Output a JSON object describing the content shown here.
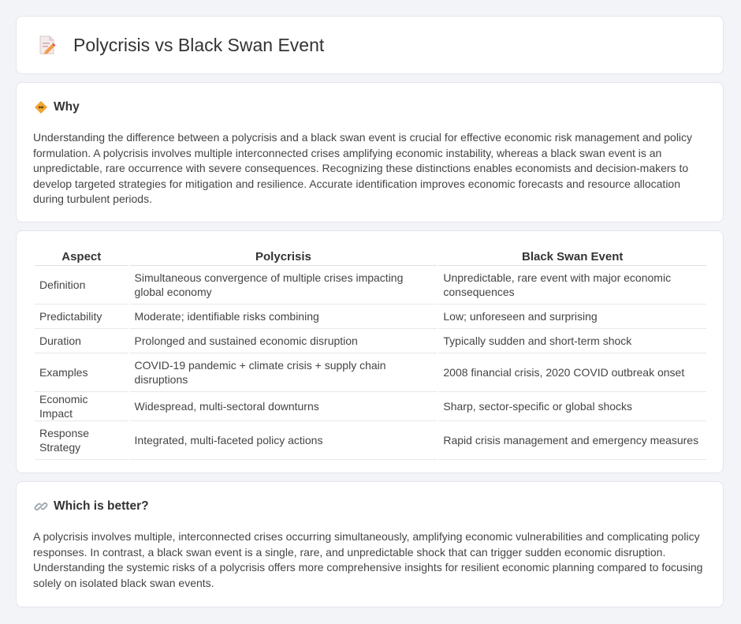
{
  "header": {
    "title": "Polycrisis vs Black Swan Event",
    "icon": "document-edit-icon"
  },
  "why": {
    "title": "Why",
    "icon": "diamond-warning-icon",
    "text": "Understanding the difference between a polycrisis and a black swan event is crucial for effective economic risk management and policy formulation. A polycrisis involves multiple interconnected crises amplifying economic instability, whereas a black swan event is an unpredictable, rare occurrence with severe consequences. Recognizing these distinctions enables economists and decision-makers to develop targeted strategies for mitigation and resilience. Accurate identification improves economic forecasts and resource allocation during turbulent periods."
  },
  "table": {
    "headers": [
      "Aspect",
      "Polycrisis",
      "Black Swan Event"
    ],
    "rows": [
      [
        "Definition",
        "Simultaneous convergence of multiple crises impacting global economy",
        "Unpredictable, rare event with major economic consequences"
      ],
      [
        "Predictability",
        "Moderate; identifiable risks combining",
        "Low; unforeseen and surprising"
      ],
      [
        "Duration",
        "Prolonged and sustained economic disruption",
        "Typically sudden and short-term shock"
      ],
      [
        "Examples",
        "COVID-19 pandemic + climate crisis + supply chain disruptions",
        "2008 financial crisis, 2020 COVID outbreak onset"
      ],
      [
        "Economic Impact",
        "Widespread, multi-sectoral downturns",
        "Sharp, sector-specific or global shocks"
      ],
      [
        "Response Strategy",
        "Integrated, multi-faceted policy actions",
        "Rapid crisis management and emergency measures"
      ]
    ]
  },
  "better": {
    "title": "Which is better?",
    "icon": "link-icon",
    "text": "A polycrisis involves multiple, interconnected crises occurring simultaneously, amplifying economic vulnerabilities and complicating policy responses. In contrast, a black swan event is a single, rare, and unpredictable shock that can trigger sudden economic disruption. Understanding the systemic risks of a polycrisis offers more comprehensive insights for resilient economic planning compared to focusing solely on isolated black swan events."
  }
}
